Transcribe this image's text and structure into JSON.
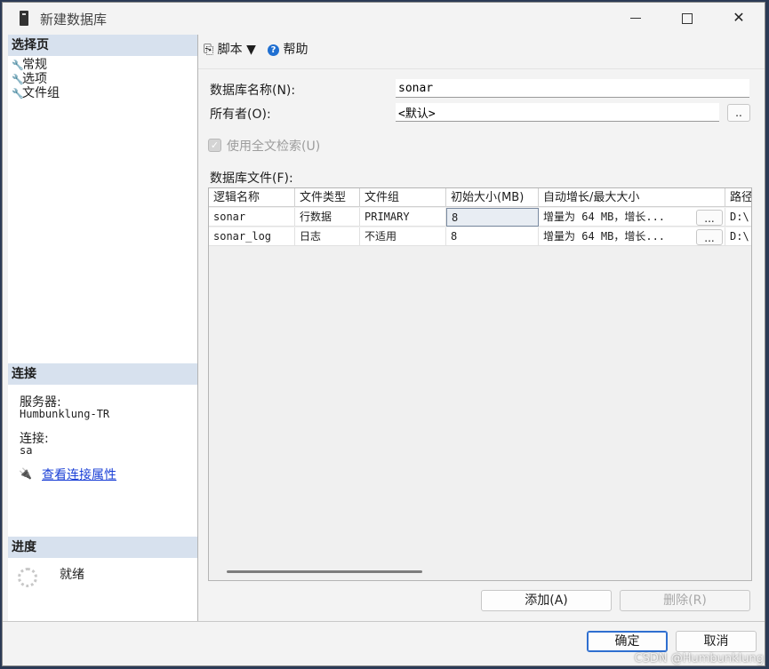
{
  "window": {
    "title": "新建数据库"
  },
  "left_panel": {
    "select_page_header": "选择页",
    "pages": [
      {
        "label": "常规"
      },
      {
        "label": "选项"
      },
      {
        "label": "文件组"
      }
    ],
    "connection_header": "连接",
    "server_label": "服务器:",
    "server_value": "Humbunklung-TR",
    "connection_label": "连接:",
    "connection_value": "sa",
    "view_properties_link": "查看连接属性",
    "progress_header": "进度",
    "progress_status": "就绪"
  },
  "toolbar": {
    "script_label": "脚本",
    "help_label": "帮助"
  },
  "form": {
    "db_name_label": "数据库名称(N):",
    "db_name_value": "sonar",
    "owner_label": "所有者(O):",
    "owner_value": "<默认>",
    "owner_browse_label": "..",
    "fulltext_label": "使用全文检索(U)",
    "db_files_label": "数据库文件(F):"
  },
  "files_table": {
    "columns": [
      "逻辑名称",
      "文件类型",
      "文件组",
      "初始大小(MB)",
      "自动增长/最大大小",
      "路径"
    ],
    "rows": [
      {
        "logical_name": "sonar",
        "file_type": "行数据",
        "filegroup": "PRIMARY",
        "initial_size": "8",
        "autogrowth": "增量为 64 MB，增长...",
        "browse": "...",
        "path": "D:\\"
      },
      {
        "logical_name": "sonar_log",
        "file_type": "日志",
        "filegroup": "不适用",
        "initial_size": "8",
        "autogrowth": "增量为 64 MB，增长...",
        "browse": "...",
        "path": "D:\\"
      }
    ]
  },
  "buttons": {
    "add": "添加(A)",
    "remove": "删除(R)",
    "ok": "确定",
    "cancel": "取消"
  },
  "watermark": "CSDN @Humbunklung"
}
